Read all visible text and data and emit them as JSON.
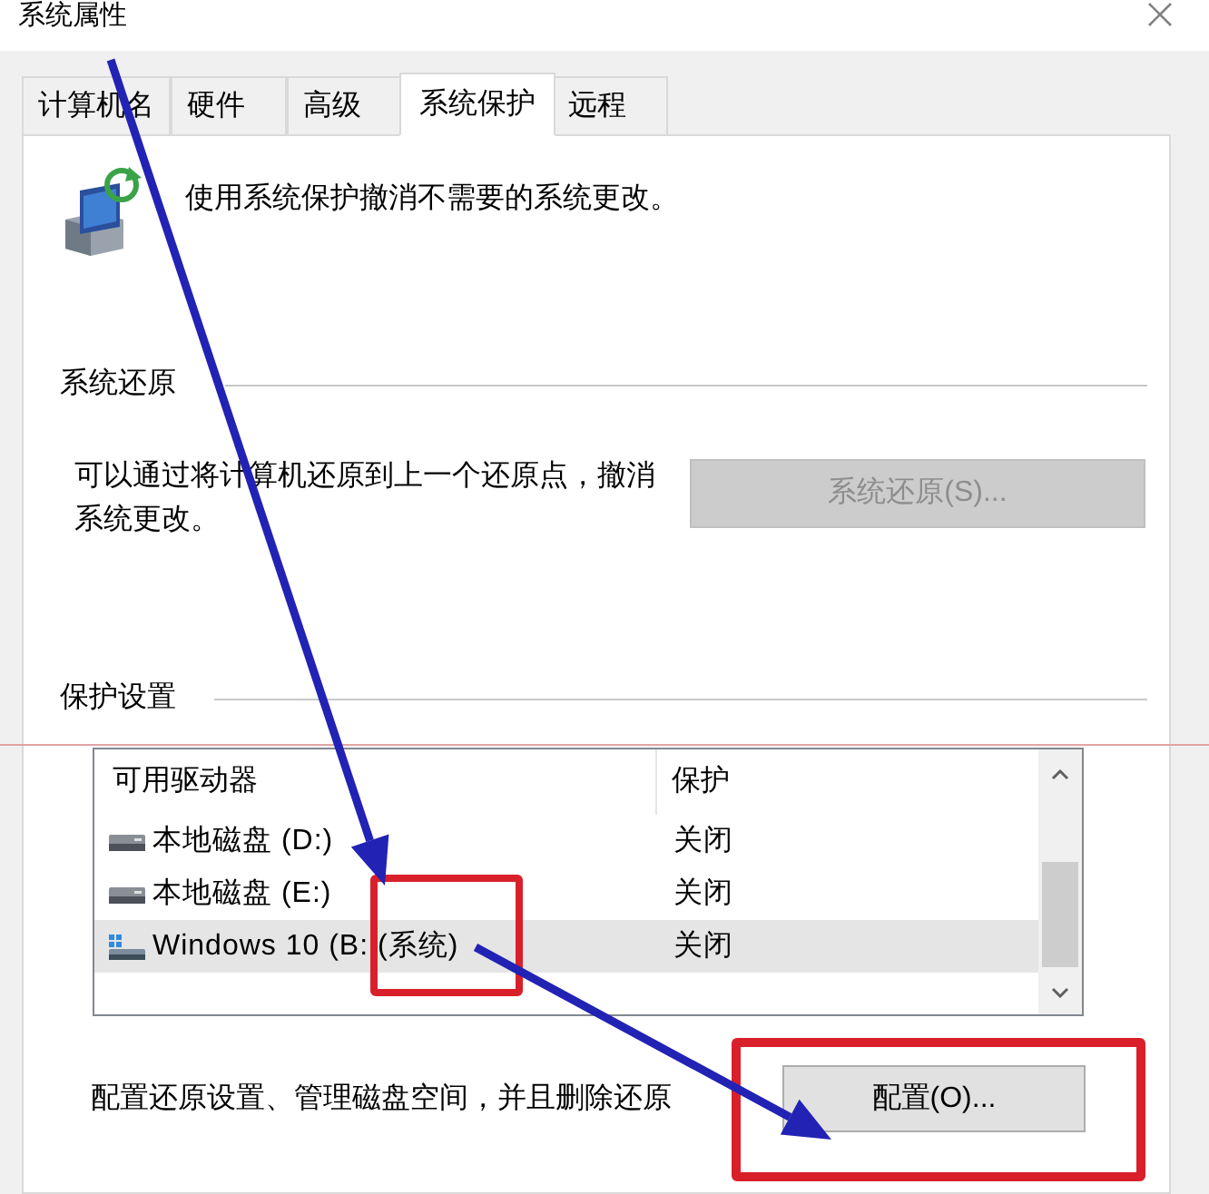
{
  "window": {
    "title": "系统属性"
  },
  "tabs": [
    {
      "label": "计算机名",
      "selected": false
    },
    {
      "label": "硬件",
      "selected": false
    },
    {
      "label": "高级",
      "selected": false
    },
    {
      "label": "系统保护",
      "selected": true
    },
    {
      "label": "远程",
      "selected": false
    }
  ],
  "intro": {
    "text": "使用系统保护撤消不需要的系统更改。"
  },
  "system_restore": {
    "title": "系统还原",
    "description": "可以通过将计算机还原到上一个还原点，撤消系统更改。",
    "button": {
      "label": "系统还原(S)...",
      "disabled": true
    }
  },
  "protection_settings": {
    "title": "保护设置",
    "drives": {
      "columns": [
        "可用驱动器",
        "保护"
      ],
      "rows": [
        {
          "kind": "disk",
          "name": "本地磁盘 (D:)",
          "protection": "关闭",
          "selected": false
        },
        {
          "kind": "disk",
          "name": "本地磁盘 (E:)",
          "protection": "关闭",
          "selected": false
        },
        {
          "kind": "system",
          "name": "Windows 10 (B: (系统)",
          "protection": "关闭",
          "selected": true
        }
      ]
    },
    "description": "配置还原设置、管理磁盘空间，并且删除还原",
    "button": {
      "label": "配置(O)...",
      "disabled": false
    }
  }
}
